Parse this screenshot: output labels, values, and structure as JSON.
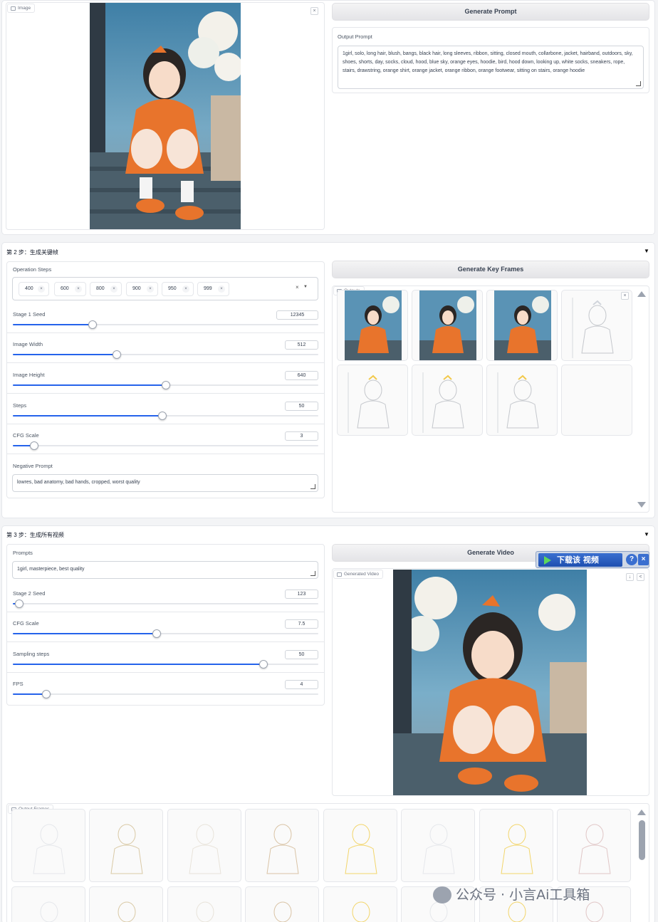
{
  "section1": {
    "image_tag": "Image",
    "generate_prompt_btn": "Generate Prompt",
    "output_prompt_label": "Output Prompt",
    "output_prompt_value": "1girl, solo, long hair, blush, bangs, black hair, long sleeves, ribbon, sitting, closed mouth, collarbone, jacket, hairband, outdoors, sky, shoes, shorts, day, socks, cloud, hood, blue sky, orange eyes, hoodie, bird, hood down, looking up, white socks, sneakers, rope, stairs, drawstring, orange shirt, orange jacket, orange ribbon, orange footwear, sitting on stairs, orange hoodie"
  },
  "section2": {
    "title": "第 2 步：生成关键帧",
    "operation_steps_label": "Operation Steps",
    "steps_chips": [
      "400",
      "600",
      "800",
      "900",
      "950",
      "999"
    ],
    "sliders": [
      {
        "label": "Stage 1 Seed",
        "value": "12345",
        "fraction": 0.26
      },
      {
        "label": "Image Width",
        "value": "512",
        "fraction": 0.34
      },
      {
        "label": "Image Height",
        "value": "640",
        "fraction": 0.5
      },
      {
        "label": "Steps",
        "value": "50",
        "fraction": 0.49
      },
      {
        "label": "CFG Scale",
        "value": "3",
        "fraction": 0.07
      }
    ],
    "negative_prompt_label": "Negative Prompt",
    "negative_prompt_value": "lowres, bad anatomy, bad hands, cropped, worst quality",
    "generate_key_frames_btn": "Generate Key Frames",
    "outputs_tag": "Outputs"
  },
  "section3": {
    "title": "第 3 步：生成所有视频",
    "prompts_label": "Prompts",
    "prompts_value": "1girl, masterpiece, best quality",
    "sliders": [
      {
        "label": "Stage 2 Seed",
        "value": "123",
        "fraction": 0.02
      },
      {
        "label": "CFG Scale",
        "value": "7.5",
        "fraction": 0.47
      },
      {
        "label": "Sampling steps",
        "value": "50",
        "fraction": 0.82
      },
      {
        "label": "FPS",
        "value": "4",
        "fraction": 0.11
      }
    ],
    "generate_video_btn": "Generate Video",
    "generated_video_tag": "Generated Video",
    "download_overlay": "下载该 视频",
    "output_frames_tag": "Output Frames"
  },
  "watermark": "公众号 · 小言Ai工具箱",
  "colors": {
    "accent": "#2563eb",
    "orange": "#e8742c",
    "sky": "#4d8fb3",
    "download_bar": "#1e4fb0"
  }
}
